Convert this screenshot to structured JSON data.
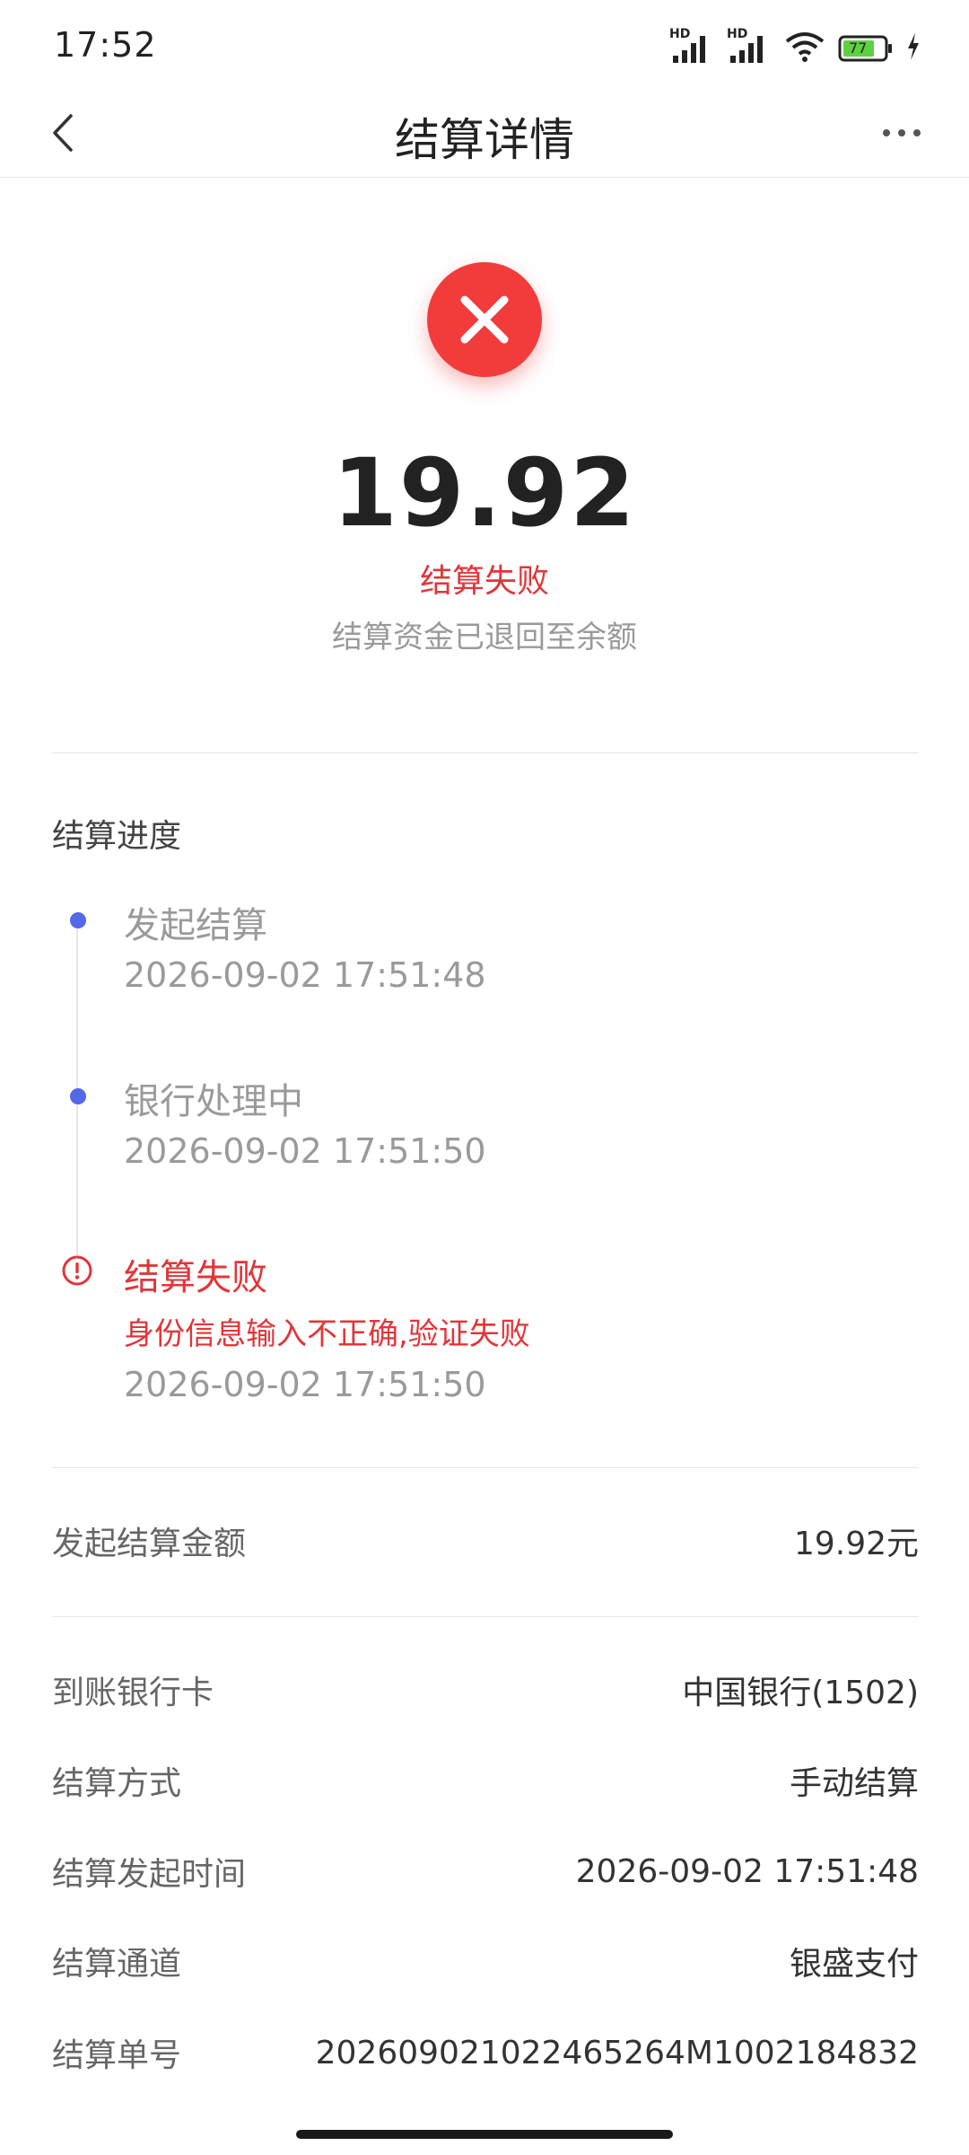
{
  "status_bar": {
    "time": "17:52",
    "signal1_label": "HD",
    "signal2_label": "HD",
    "battery_level": "77",
    "icons": [
      "signal-icon",
      "signal-icon",
      "wifi-icon",
      "battery-icon",
      "charging-icon"
    ]
  },
  "nav": {
    "title": "结算详情"
  },
  "result": {
    "amount": "19.92",
    "status": "结算失败",
    "subtitle": "结算资金已退回至余额"
  },
  "progress": {
    "section_title": "结算进度",
    "steps": [
      {
        "title": "发起结算",
        "time": "2026-09-02 17:51:48"
      },
      {
        "title": "银行处理中",
        "time": "2026-09-02 17:51:50"
      },
      {
        "title": "结算失败",
        "reason": "身份信息输入不正确,验证失败",
        "time": "2026-09-02 17:51:50"
      }
    ]
  },
  "summary": {
    "amount_label": "发起结算金额",
    "amount_value": "19.92元"
  },
  "details": [
    {
      "label": "到账银行卡",
      "value": "中国银行(1502)"
    },
    {
      "label": "结算方式",
      "value": "手动结算"
    },
    {
      "label": "结算发起时间",
      "value": "2026-09-02 17:51:48"
    },
    {
      "label": "结算通道",
      "value": "银盛支付"
    },
    {
      "label": "结算单号",
      "value": "202609021022465264M1002184832"
    }
  ],
  "colors": {
    "error_red": "#f23c3c",
    "timeline_blue": "#5468ea",
    "muted_gray": "#9a9a9a"
  }
}
